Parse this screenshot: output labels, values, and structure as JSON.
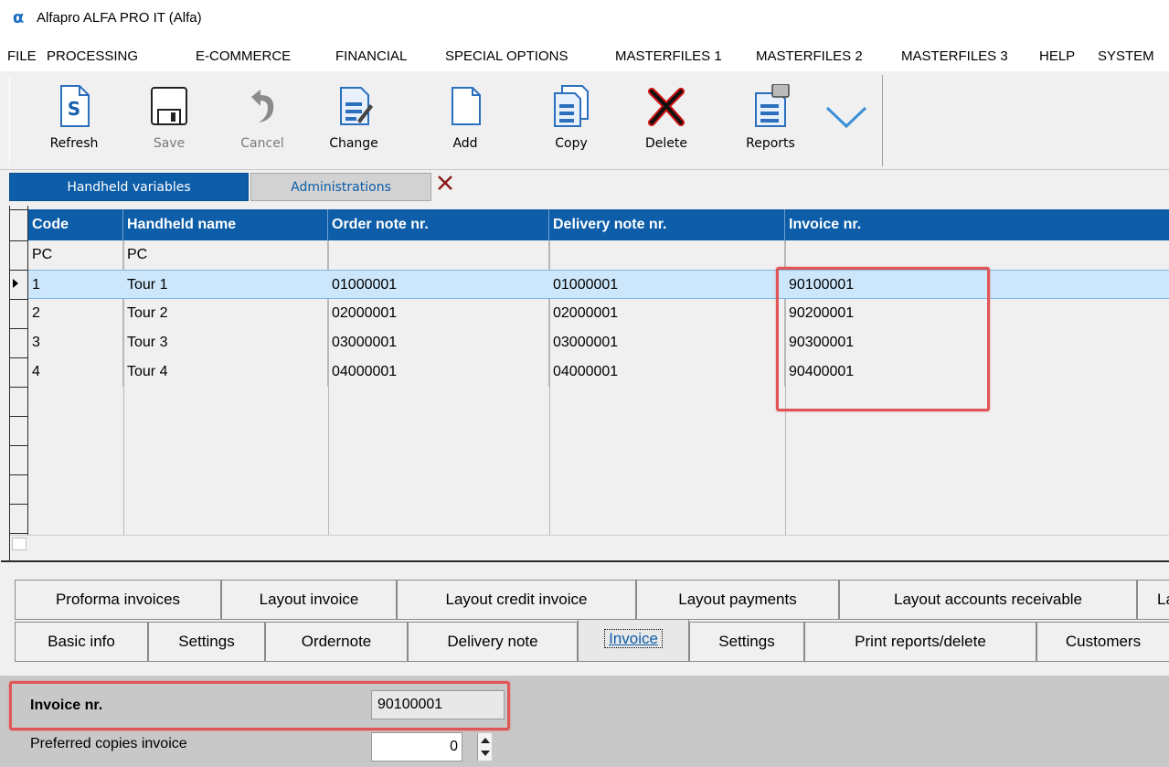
{
  "window": {
    "title": "Alfapro ALFA PRO IT (Alfa)",
    "logo_icon": "alpha-logo-icon"
  },
  "menu": [
    "FILE",
    "PROCESSING",
    "E-COMMERCE",
    "FINANCIAL",
    "SPECIAL OPTIONS",
    "MASTERFILES 1",
    "MASTERFILES 2",
    "MASTERFILES 3",
    "HELP",
    "SYSTEM"
  ],
  "toolbar": {
    "refresh": "Refresh",
    "save": "Save",
    "cancel": "Cancel",
    "change": "Change",
    "add": "Add",
    "copy": "Copy",
    "delete": "Delete",
    "reports": "Reports"
  },
  "top_tabs": {
    "active": "Handheld variables",
    "inactive": "Administrations"
  },
  "grid": {
    "columns": [
      "Code",
      "Handheld name",
      "Order note nr.",
      "Delivery note nr.",
      "Invoice nr."
    ],
    "rows": [
      [
        "PC",
        "PC",
        "",
        "",
        ""
      ],
      [
        "1",
        "Tour 1",
        "01000001",
        "01000001",
        "90100001"
      ],
      [
        "2",
        "Tour 2",
        "02000001",
        "02000001",
        "90200001"
      ],
      [
        "3",
        "Tour 3",
        "03000001",
        "03000001",
        "90300001"
      ],
      [
        "4",
        "Tour 4",
        "04000001",
        "04000001",
        "90400001"
      ]
    ],
    "selected_row": 1
  },
  "lower_tabs_row1": [
    "Proforma invoices",
    "Layout invoice",
    "Layout credit invoice",
    "Layout payments",
    "Layout accounts receivable",
    "La"
  ],
  "lower_tabs_row2": [
    "Basic info",
    "Settings",
    "Ordernote",
    "Delivery note",
    "Invoice",
    "Settings",
    "Print reports/delete",
    "Customers"
  ],
  "form": {
    "invoice_nr_label": "Invoice nr.",
    "invoice_nr_value": "90100001",
    "preferred_copies_label": "Preferred copies invoice",
    "preferred_copies_value": "0"
  },
  "colors": {
    "accent": "#0d5da8",
    "highlight": "#e05555",
    "selected_row": "#cce6fb"
  }
}
